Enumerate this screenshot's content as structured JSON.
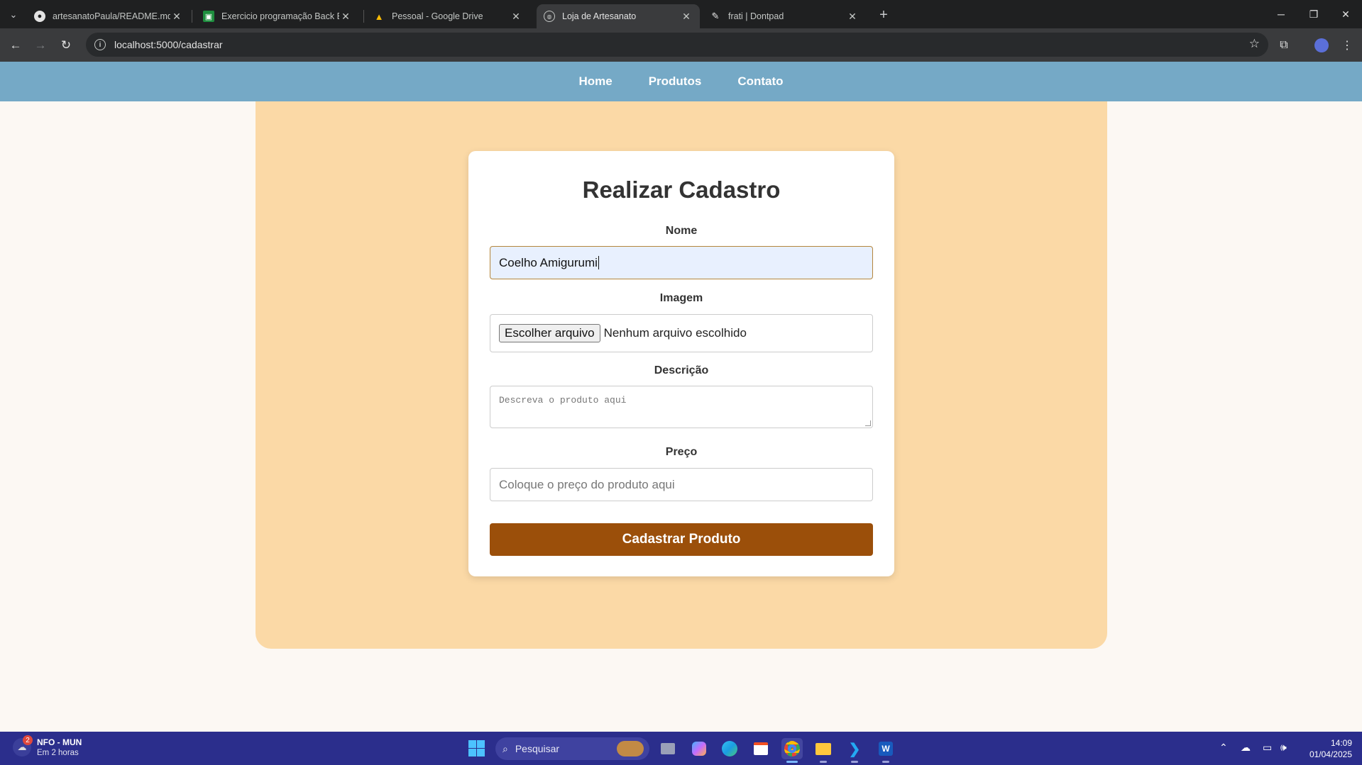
{
  "browser": {
    "tabs": [
      {
        "title": "artesanatoPaula/README.md at",
        "favicon": "github-icon",
        "active": false
      },
      {
        "title": "Exercicio programação Back En",
        "favicon": "classroom-icon",
        "active": false
      },
      {
        "title": "Pessoal - Google Drive",
        "favicon": "google-drive-icon",
        "active": false
      },
      {
        "title": "Loja de Artesanato",
        "favicon": "globe-icon",
        "active": true
      },
      {
        "title": "frati | Dontpad",
        "favicon": "dontpad-icon",
        "active": false
      }
    ],
    "url": "localhost:5000/cadastrar"
  },
  "site_nav": {
    "links": [
      "Home",
      "Produtos",
      "Contato"
    ]
  },
  "form": {
    "title": "Realizar Cadastro",
    "name_label": "Nome",
    "name_value": "Coelho Amigurumi",
    "image_label": "Imagem",
    "file_button": "Escolher arquivo",
    "file_status": "Nenhum arquivo escolhido",
    "description_label": "Descrição",
    "description_placeholder": "Descreva o produto aqui",
    "price_label": "Preço",
    "price_placeholder": "Coloque o preço do produto aqui",
    "submit_label": "Cadastrar Produto"
  },
  "taskbar": {
    "news_badge": "2",
    "news_title": "NFO - MUN",
    "news_subtitle": "Em 2 horas",
    "search_placeholder": "Pesquisar",
    "time": "14:09",
    "date": "01/04/2025"
  },
  "colors": {
    "nav_bg": "#75a9c6",
    "panel_bg": "#fbd9a6",
    "submit_bg": "#9b4f0a",
    "taskbar_bg": "#2b2e8c"
  }
}
